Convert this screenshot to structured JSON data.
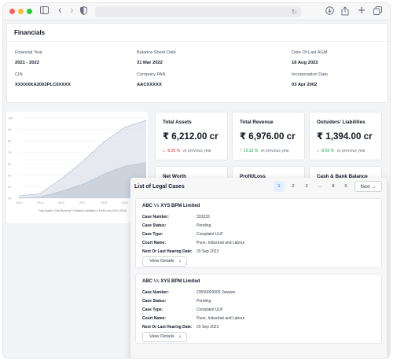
{
  "browser": {
    "nav_back": "‹",
    "nav_forward": "›",
    "reload": "↻"
  },
  "financials": {
    "title": "Financials",
    "fields": [
      {
        "label": "Financial Year",
        "value": "2021 - 2022"
      },
      {
        "label": "Balance Sheet Date",
        "value": "31 Mar 2022"
      },
      {
        "label": "Date Of Last AGM",
        "value": "16 Aug 2022"
      },
      {
        "label": "CIN",
        "value": "XXXXXKA2002PLC0XXXX"
      },
      {
        "label": "Company PAN",
        "value": "AACXXXXX"
      },
      {
        "label": "Incorporation Date",
        "value": "03 Apr 2002"
      }
    ]
  },
  "chart_data": {
    "type": "area",
    "x": [
      "2012",
      "2014",
      "2015",
      "2017",
      "2019",
      "2020",
      "2021"
    ],
    "y_ticks": [
      "10K",
      "9K",
      "8K",
      "7K",
      "6K",
      "5K",
      "4K",
      "3K"
    ],
    "caption": "Total Assets, Total Revenue, Outsiders Liabilities & Profit Loss (2012-2022)",
    "series": [
      {
        "values": [
          3200,
          3400,
          4700,
          6200,
          7900,
          9200,
          9800
        ],
        "color": "#dde2e9"
      },
      {
        "values": [
          3000,
          3100,
          3600,
          4200,
          5100,
          5800,
          6100
        ],
        "color": "#c9d0da"
      }
    ]
  },
  "stats": [
    {
      "title": "Total Assets",
      "value": "₹ 6,212.00 cr",
      "trend": "-5.25 %",
      "direction": "down",
      "suffix": "vs previous year"
    },
    {
      "title": "Total Revenue",
      "value": "₹ 6,976.00 cr",
      "trend": "23.32 %",
      "direction": "up",
      "suffix": "vs previous year"
    },
    {
      "title": "Outsiders’ Liabilities",
      "value": "₹ 1,394.00 cr",
      "trend": "-8.65 %",
      "direction": "down",
      "suffix": "vs previous year"
    }
  ],
  "small_cards": [
    "Net Worth",
    "Profit/Loss",
    "Cash & Bank Balance"
  ],
  "legal": {
    "title": "List of Legal Cases",
    "pages": [
      "1",
      "2",
      "3",
      "...",
      "8",
      "9"
    ],
    "active_page": "1",
    "next_label": "Next",
    "labels": {
      "case_number": "Case Number:",
      "case_status": "Case Status:",
      "case_type": "Case Type:",
      "court_name": "Court Name:",
      "next_hearing": "Next Or Last Hearing Date:"
    },
    "view_label": "View Details",
    "cases": [
      {
        "title_a": "ABC",
        "title_b": "XYS BPM Limited",
        "vs": "Vs",
        "case_number": "333333",
        "case_status": "Pending",
        "case_type": "Complaint ULP",
        "court_name": "Pune, Industrial and Labour",
        "next_hearing": "20 Sep 2022"
      },
      {
        "title_a": "ABC",
        "title_b": "XYS BPM Limited",
        "vs": "Vs",
        "case_number": "23550000005 2wwww",
        "case_status": "Pending",
        "case_type": "Complaint ULP",
        "court_name": "Pune, Industrial and Labour",
        "next_hearing": "20 Sep 2022"
      }
    ]
  }
}
